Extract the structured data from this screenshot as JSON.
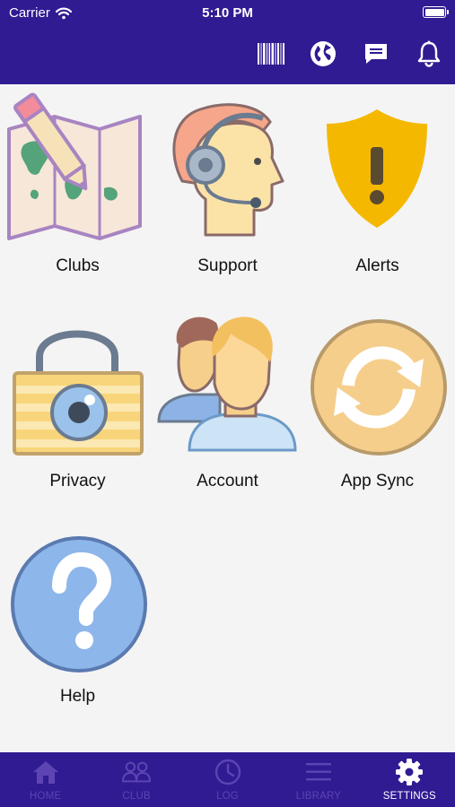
{
  "status_bar": {
    "carrier": "Carrier",
    "time": "5:10 PM",
    "icons": [
      "wifi-icon",
      "battery-icon"
    ]
  },
  "header": {
    "icons": [
      "barcode-icon",
      "globe-icon",
      "chat-icon",
      "bell-icon"
    ],
    "background_color": "#311b92"
  },
  "tiles": [
    {
      "label": "Clubs",
      "icon": "map-pencil-icon"
    },
    {
      "label": "Support",
      "icon": "headset-person-icon"
    },
    {
      "label": "Alerts",
      "icon": "shield-exclamation-icon"
    },
    {
      "label": "Privacy",
      "icon": "padlock-eye-icon"
    },
    {
      "label": "Account",
      "icon": "users-icon"
    },
    {
      "label": "App Sync",
      "icon": "sync-icon"
    },
    {
      "label": "Help",
      "icon": "question-icon"
    }
  ],
  "tabbar": {
    "tabs": [
      {
        "label": "HOME",
        "icon": "home-icon",
        "active": false
      },
      {
        "label": "CLUB",
        "icon": "group-icon",
        "active": false
      },
      {
        "label": "LOG",
        "icon": "clock-icon",
        "active": false
      },
      {
        "label": "LIBRARY",
        "icon": "menu-lines-icon",
        "active": false
      },
      {
        "label": "SETTINGS",
        "icon": "gear-icon",
        "active": true
      }
    ],
    "active_color": "#ffffff",
    "inactive_color": "#5c44b2"
  }
}
